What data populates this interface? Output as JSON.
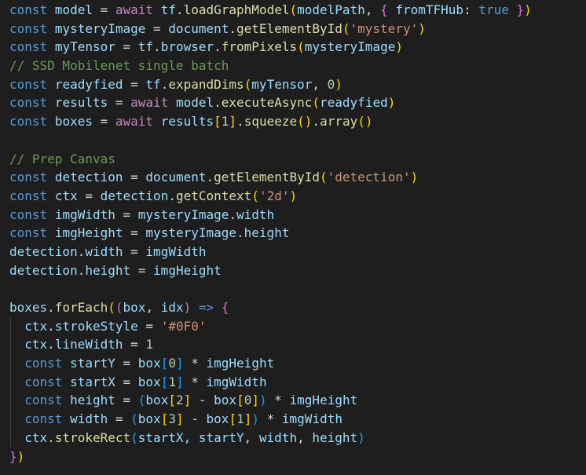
{
  "editor": {
    "indent_guide_color": "#404040",
    "lines": [
      {
        "indent": false,
        "tokens": [
          [
            "k",
            "const"
          ],
          [
            "p",
            " "
          ],
          [
            "v",
            "model"
          ],
          [
            "p",
            " = "
          ],
          [
            "c",
            "await"
          ],
          [
            "p",
            " "
          ],
          [
            "v",
            "tf"
          ],
          [
            "p",
            "."
          ],
          [
            "f",
            "loadGraphModel"
          ],
          [
            "b1",
            "("
          ],
          [
            "v",
            "modelPath"
          ],
          [
            "p",
            ", "
          ],
          [
            "b2",
            "{"
          ],
          [
            "p",
            " "
          ],
          [
            "v",
            "fromTFHub"
          ],
          [
            "p",
            ": "
          ],
          [
            "k",
            "true"
          ],
          [
            "p",
            " "
          ],
          [
            "b2",
            "}"
          ],
          [
            "b1",
            ")"
          ]
        ]
      },
      {
        "indent": false,
        "tokens": [
          [
            "k",
            "const"
          ],
          [
            "p",
            " "
          ],
          [
            "v",
            "mysteryImage"
          ],
          [
            "p",
            " = "
          ],
          [
            "v",
            "document"
          ],
          [
            "p",
            "."
          ],
          [
            "f",
            "getElementById"
          ],
          [
            "b1",
            "("
          ],
          [
            "s",
            "'mystery'"
          ],
          [
            "b1",
            ")"
          ]
        ]
      },
      {
        "indent": false,
        "tokens": [
          [
            "k",
            "const"
          ],
          [
            "p",
            " "
          ],
          [
            "v",
            "myTensor"
          ],
          [
            "p",
            " = "
          ],
          [
            "v",
            "tf"
          ],
          [
            "p",
            "."
          ],
          [
            "v",
            "browser"
          ],
          [
            "p",
            "."
          ],
          [
            "f",
            "fromPixels"
          ],
          [
            "b1",
            "("
          ],
          [
            "v",
            "mysteryImage"
          ],
          [
            "b1",
            ")"
          ]
        ]
      },
      {
        "indent": false,
        "tokens": [
          [
            "m",
            "// SSD Mobilenet single batch"
          ]
        ]
      },
      {
        "indent": false,
        "tokens": [
          [
            "k",
            "const"
          ],
          [
            "p",
            " "
          ],
          [
            "v",
            "readyfied"
          ],
          [
            "p",
            " = "
          ],
          [
            "v",
            "tf"
          ],
          [
            "p",
            "."
          ],
          [
            "f",
            "expandDims"
          ],
          [
            "b1",
            "("
          ],
          [
            "v",
            "myTensor"
          ],
          [
            "p",
            ", "
          ],
          [
            "n",
            "0"
          ],
          [
            "b1",
            ")"
          ]
        ]
      },
      {
        "indent": false,
        "tokens": [
          [
            "k",
            "const"
          ],
          [
            "p",
            " "
          ],
          [
            "v",
            "results"
          ],
          [
            "p",
            " = "
          ],
          [
            "c",
            "await"
          ],
          [
            "p",
            " "
          ],
          [
            "v",
            "model"
          ],
          [
            "p",
            "."
          ],
          [
            "f",
            "executeAsync"
          ],
          [
            "b1",
            "("
          ],
          [
            "v",
            "readyfied"
          ],
          [
            "b1",
            ")"
          ]
        ]
      },
      {
        "indent": false,
        "tokens": [
          [
            "k",
            "const"
          ],
          [
            "p",
            " "
          ],
          [
            "v",
            "boxes"
          ],
          [
            "p",
            " = "
          ],
          [
            "c",
            "await"
          ],
          [
            "p",
            " "
          ],
          [
            "v",
            "results"
          ],
          [
            "b1",
            "["
          ],
          [
            "n",
            "1"
          ],
          [
            "b1",
            "]"
          ],
          [
            "p",
            "."
          ],
          [
            "f",
            "squeeze"
          ],
          [
            "b1",
            "("
          ],
          [
            "b1",
            ")"
          ],
          [
            "p",
            "."
          ],
          [
            "f",
            "array"
          ],
          [
            "b1",
            "("
          ],
          [
            "b1",
            ")"
          ]
        ]
      },
      {
        "indent": false,
        "tokens": []
      },
      {
        "indent": false,
        "tokens": [
          [
            "m",
            "// Prep Canvas"
          ]
        ]
      },
      {
        "indent": false,
        "tokens": [
          [
            "k",
            "const"
          ],
          [
            "p",
            " "
          ],
          [
            "v",
            "detection"
          ],
          [
            "p",
            " = "
          ],
          [
            "v",
            "document"
          ],
          [
            "p",
            "."
          ],
          [
            "f",
            "getElementById"
          ],
          [
            "b1",
            "("
          ],
          [
            "s",
            "'detection'"
          ],
          [
            "b1",
            ")"
          ]
        ]
      },
      {
        "indent": false,
        "tokens": [
          [
            "k",
            "const"
          ],
          [
            "p",
            " "
          ],
          [
            "v",
            "ctx"
          ],
          [
            "p",
            " = "
          ],
          [
            "v",
            "detection"
          ],
          [
            "p",
            "."
          ],
          [
            "f",
            "getContext"
          ],
          [
            "b1",
            "("
          ],
          [
            "s",
            "'2d'"
          ],
          [
            "b1",
            ")"
          ]
        ]
      },
      {
        "indent": false,
        "tokens": [
          [
            "k",
            "const"
          ],
          [
            "p",
            " "
          ],
          [
            "v",
            "imgWidth"
          ],
          [
            "p",
            " = "
          ],
          [
            "v",
            "mysteryImage"
          ],
          [
            "p",
            "."
          ],
          [
            "v",
            "width"
          ]
        ]
      },
      {
        "indent": false,
        "tokens": [
          [
            "k",
            "const"
          ],
          [
            "p",
            " "
          ],
          [
            "v",
            "imgHeight"
          ],
          [
            "p",
            " = "
          ],
          [
            "v",
            "mysteryImage"
          ],
          [
            "p",
            "."
          ],
          [
            "v",
            "height"
          ]
        ]
      },
      {
        "indent": false,
        "tokens": [
          [
            "v",
            "detection"
          ],
          [
            "p",
            "."
          ],
          [
            "v",
            "width"
          ],
          [
            "p",
            " = "
          ],
          [
            "v",
            "imgWidth"
          ]
        ]
      },
      {
        "indent": false,
        "tokens": [
          [
            "v",
            "detection"
          ],
          [
            "p",
            "."
          ],
          [
            "v",
            "height"
          ],
          [
            "p",
            " = "
          ],
          [
            "v",
            "imgHeight"
          ]
        ]
      },
      {
        "indent": false,
        "tokens": []
      },
      {
        "indent": false,
        "tokens": [
          [
            "v",
            "boxes"
          ],
          [
            "p",
            "."
          ],
          [
            "f",
            "forEach"
          ],
          [
            "b1",
            "("
          ],
          [
            "b2",
            "("
          ],
          [
            "v",
            "box"
          ],
          [
            "p",
            ", "
          ],
          [
            "v",
            "idx"
          ],
          [
            "b2",
            ")"
          ],
          [
            "p",
            " "
          ],
          [
            "k",
            "=>"
          ],
          [
            "p",
            " "
          ],
          [
            "b2",
            "{"
          ]
        ]
      },
      {
        "indent": true,
        "tokens": [
          [
            "p",
            "  "
          ],
          [
            "v",
            "ctx"
          ],
          [
            "p",
            "."
          ],
          [
            "v",
            "strokeStyle"
          ],
          [
            "p",
            " = "
          ],
          [
            "s",
            "'#0F0'"
          ]
        ]
      },
      {
        "indent": true,
        "tokens": [
          [
            "p",
            "  "
          ],
          [
            "v",
            "ctx"
          ],
          [
            "p",
            "."
          ],
          [
            "v",
            "lineWidth"
          ],
          [
            "p",
            " = "
          ],
          [
            "n",
            "1"
          ]
        ]
      },
      {
        "indent": true,
        "tokens": [
          [
            "p",
            "  "
          ],
          [
            "k",
            "const"
          ],
          [
            "p",
            " "
          ],
          [
            "v",
            "startY"
          ],
          [
            "p",
            " = "
          ],
          [
            "v",
            "box"
          ],
          [
            "b3",
            "["
          ],
          [
            "n",
            "0"
          ],
          [
            "b3",
            "]"
          ],
          [
            "p",
            " * "
          ],
          [
            "v",
            "imgHeight"
          ]
        ]
      },
      {
        "indent": true,
        "tokens": [
          [
            "p",
            "  "
          ],
          [
            "k",
            "const"
          ],
          [
            "p",
            " "
          ],
          [
            "v",
            "startX"
          ],
          [
            "p",
            " = "
          ],
          [
            "v",
            "box"
          ],
          [
            "b3",
            "["
          ],
          [
            "n",
            "1"
          ],
          [
            "b3",
            "]"
          ],
          [
            "p",
            " * "
          ],
          [
            "v",
            "imgWidth"
          ]
        ]
      },
      {
        "indent": true,
        "tokens": [
          [
            "p",
            "  "
          ],
          [
            "k",
            "const"
          ],
          [
            "p",
            " "
          ],
          [
            "v",
            "height"
          ],
          [
            "p",
            " = "
          ],
          [
            "b3",
            "("
          ],
          [
            "v",
            "box"
          ],
          [
            "b1",
            "["
          ],
          [
            "n",
            "2"
          ],
          [
            "b1",
            "]"
          ],
          [
            "p",
            " - "
          ],
          [
            "v",
            "box"
          ],
          [
            "b1",
            "["
          ],
          [
            "n",
            "0"
          ],
          [
            "b1",
            "]"
          ],
          [
            "b3",
            ")"
          ],
          [
            "p",
            " * "
          ],
          [
            "v",
            "imgHeight"
          ]
        ]
      },
      {
        "indent": true,
        "tokens": [
          [
            "p",
            "  "
          ],
          [
            "k",
            "const"
          ],
          [
            "p",
            " "
          ],
          [
            "v",
            "width"
          ],
          [
            "p",
            " = "
          ],
          [
            "b3",
            "("
          ],
          [
            "v",
            "box"
          ],
          [
            "b1",
            "["
          ],
          [
            "n",
            "3"
          ],
          [
            "b1",
            "]"
          ],
          [
            "p",
            " - "
          ],
          [
            "v",
            "box"
          ],
          [
            "b1",
            "["
          ],
          [
            "n",
            "1"
          ],
          [
            "b1",
            "]"
          ],
          [
            "b3",
            ")"
          ],
          [
            "p",
            " * "
          ],
          [
            "v",
            "imgWidth"
          ]
        ]
      },
      {
        "indent": true,
        "tokens": [
          [
            "p",
            "  "
          ],
          [
            "v",
            "ctx"
          ],
          [
            "p",
            "."
          ],
          [
            "f",
            "strokeRect"
          ],
          [
            "b3",
            "("
          ],
          [
            "v",
            "startX"
          ],
          [
            "p",
            ", "
          ],
          [
            "v",
            "startY"
          ],
          [
            "p",
            ", "
          ],
          [
            "v",
            "width"
          ],
          [
            "p",
            ", "
          ],
          [
            "v",
            "height"
          ],
          [
            "b3",
            ")"
          ]
        ]
      },
      {
        "indent": false,
        "tokens": [
          [
            "b2",
            "}"
          ],
          [
            "b1",
            ")"
          ]
        ]
      }
    ]
  }
}
